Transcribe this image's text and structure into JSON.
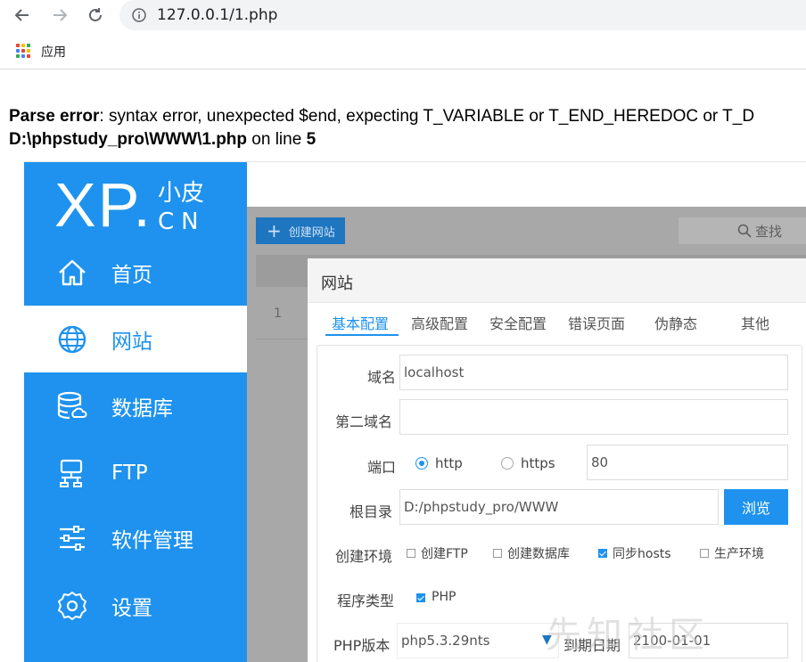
{
  "browser": {
    "url": "127.0.0.1/1.php",
    "bookmarks": [
      {
        "label": "应用"
      }
    ]
  },
  "error": {
    "label": "Parse error",
    "message": ": syntax error, unexpected $end, expecting T_VARIABLE or T_END_HEREDOC or T_D",
    "file": "D:\\phpstudy_pro\\WWW\\1.php",
    "on_line": " on line ",
    "line": "5"
  },
  "logo": {
    "brand": "XP.",
    "cn_line1": "小皮",
    "cn_line2": "CN"
  },
  "sidebar": {
    "items": [
      {
        "label": "首页",
        "icon": "home-icon"
      },
      {
        "label": "网站",
        "icon": "globe-icon",
        "active": true
      },
      {
        "label": "数据库",
        "icon": "database-icon"
      },
      {
        "label": "FTP",
        "icon": "ftp-icon"
      },
      {
        "label": "软件管理",
        "icon": "sliders-icon"
      },
      {
        "label": "设置",
        "icon": "gear-icon"
      }
    ]
  },
  "content": {
    "create_button": "创建网站",
    "search_placeholder": "查找",
    "row_number": "1"
  },
  "modal": {
    "title": "网站",
    "tabs": [
      "基本配置",
      "高级配置",
      "安全配置",
      "错误页面",
      "伪静态",
      "其他"
    ],
    "form": {
      "domain_label": "域名",
      "domain_value": "localhost",
      "second_domain_label": "第二域名",
      "second_domain_value": "",
      "port_label": "端口",
      "http_label": "http",
      "https_label": "https",
      "port_value": "80",
      "root_label": "根目录",
      "root_value": "D:/phpstudy_pro/WWW",
      "browse_label": "浏览",
      "env_label": "创建环境",
      "env_options": [
        {
          "label": "创建FTP",
          "checked": false
        },
        {
          "label": "创建数据库",
          "checked": false
        },
        {
          "label": "同步hosts",
          "checked": true
        },
        {
          "label": "生产环境",
          "checked": false
        }
      ],
      "program_label": "程序类型",
      "program_option": "PHP",
      "php_version_label": "PHP版本",
      "php_version_value": "php5.3.29nts",
      "expire_label": "到期日期",
      "expire_value": "2100-01-01"
    }
  },
  "watermark": "先知社区",
  "colors": {
    "sidebar": "#1e92ee",
    "accent": "#1e92ee"
  }
}
